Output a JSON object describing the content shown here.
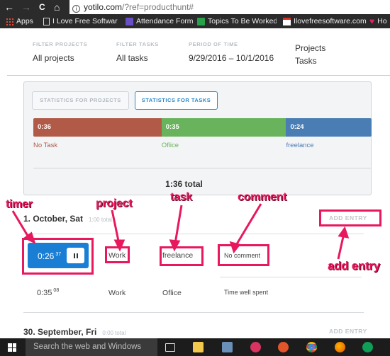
{
  "browser": {
    "url_host": "yotilo.com",
    "url_path": "/?ref=producthunt#",
    "nav": {
      "back": "←",
      "forward": "→",
      "reload": "C",
      "home": "⌂"
    },
    "bookmarks": [
      {
        "label": "Apps",
        "icon": "apps-grid-icon"
      },
      {
        "label": "I Love Free Software",
        "icon": "page-icon"
      },
      {
        "label": "Attendance Form",
        "icon": "forms-icon"
      },
      {
        "label": "Topics To Be Worked",
        "icon": "sheets-icon"
      },
      {
        "label": "Ilovefreesoftware.com",
        "icon": "gmail-icon"
      },
      {
        "label": "Ho",
        "icon": "heart-icon"
      }
    ]
  },
  "filters": {
    "projects_label": "FILTER PROJECTS",
    "projects_value": "All projects",
    "tasks_label": "FILTER TASKS",
    "tasks_value": "All tasks",
    "period_label": "PERIOD OF TIME",
    "period_value": "9/29/2016 – 10/1/2016",
    "view_projects": "Projects",
    "view_tasks": "Tasks"
  },
  "stats": {
    "tab_projects": "STATISTICS FOR PROJECTS",
    "tab_tasks": "STATISTICS FOR TASKS",
    "active_tab": "tasks",
    "total": "1:36 total",
    "segments": [
      {
        "label": "No Task",
        "time": "0:36",
        "minutes": 36,
        "color": "#b05a47"
      },
      {
        "label": "Oflice",
        "time": "0:35",
        "minutes": 35,
        "color": "#68b35b"
      },
      {
        "label": "freelance",
        "time": "0:24",
        "minutes": 24,
        "color": "#4a7db3"
      }
    ]
  },
  "days": [
    {
      "title": "1. October, Sat",
      "total": "1:00 total",
      "add_entry": "ADD ENTRY",
      "entries": [
        {
          "time": "0:26",
          "seconds": "37",
          "project": "Work",
          "task": "freelance",
          "comment": "No comment",
          "running": true
        },
        {
          "time": "0:35",
          "seconds": "08",
          "project": "Work",
          "task": "Oflice",
          "comment": "Time well spent",
          "running": false
        }
      ]
    },
    {
      "title": "30. September, Fri",
      "total": "0:00 total",
      "add_entry": "ADD ENTRY"
    }
  ],
  "annotations": {
    "timer": "timer",
    "project": "project",
    "task": "task",
    "comment": "comment",
    "add_entry": "add entry",
    "color": "#e8185e"
  },
  "taskbar": {
    "search_placeholder": "Search the web and Windows"
  }
}
